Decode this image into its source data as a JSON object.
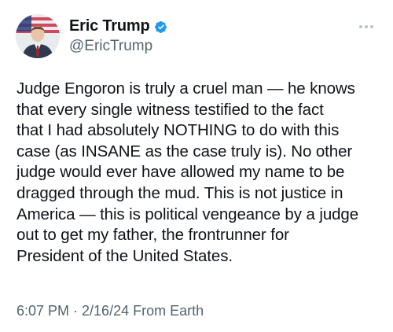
{
  "author": {
    "display_name": "Eric Trump",
    "handle": "@EricTrump",
    "verified_icon": "verified-badge-icon",
    "accent_color": "#1d9bf0"
  },
  "menu": {
    "more_icon": "more-options-icon"
  },
  "tweet": {
    "lines": [
      "Judge Engoron is truly a cruel man — he knows",
      "that every single witness testified to the fact",
      "that I had absolutely NOTHING to do with this",
      "case (as INSANE as the case truly is). No other",
      "judge would ever have allowed my name to be",
      "dragged through the mud. This is not justice in",
      "America — this is political vengeance by a judge",
      "out to get my father, the frontrunner for",
      "President of the United States."
    ]
  },
  "meta": {
    "timestamp": "6:07 PM · 2/16/24 From Earth"
  }
}
